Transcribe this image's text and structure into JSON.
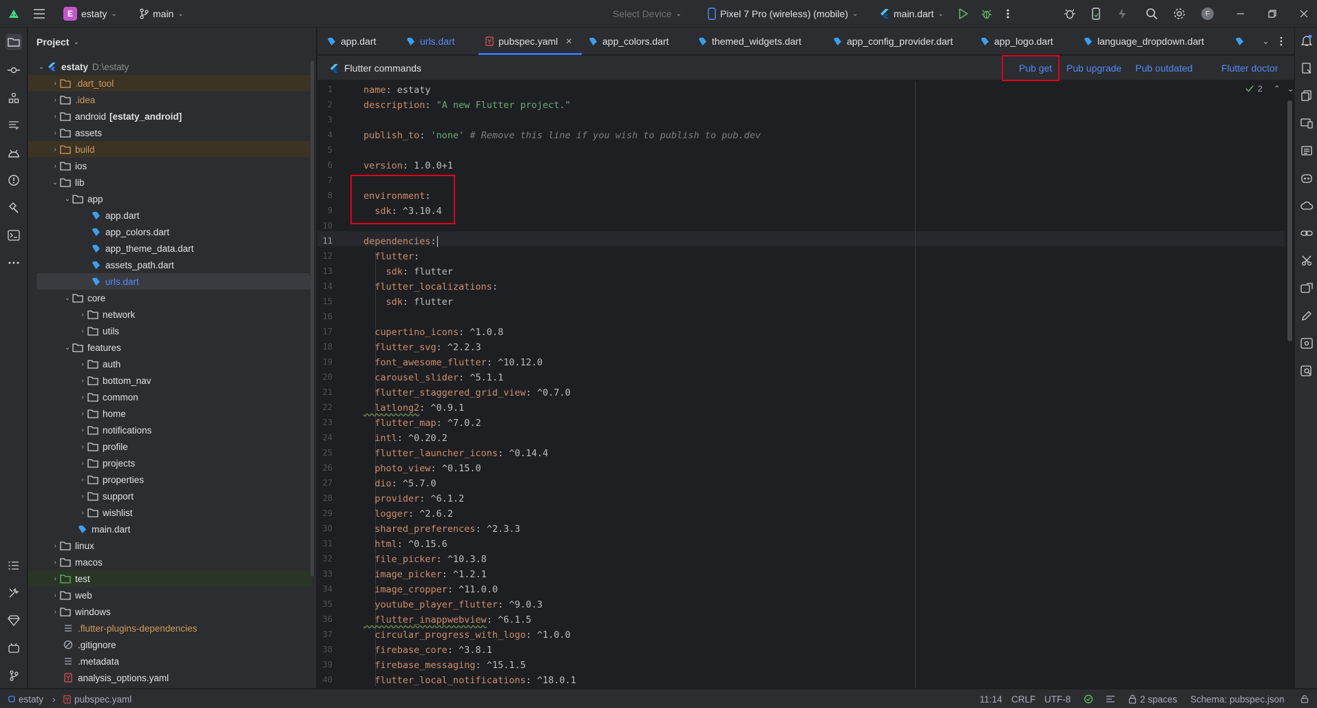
{
  "titlebar": {
    "project_badge": "E",
    "project_name": "estaty",
    "branch": "main",
    "select_device": "Select Device",
    "device": "Pixel 7 Pro (wireless) (mobile)",
    "run_config": "main.dart"
  },
  "project_panel": {
    "title": "Project",
    "root_name": "estaty",
    "root_path": "D:\\estaty",
    "items": [
      {
        "label": ".dart_tool",
        "suffix": ""
      },
      {
        "label": ".idea",
        "suffix": ""
      },
      {
        "label": "android",
        "suffix": "[estaty_android]"
      },
      {
        "label": "assets",
        "suffix": ""
      },
      {
        "label": "build",
        "suffix": ""
      },
      {
        "label": "ios",
        "suffix": ""
      },
      {
        "label": "lib",
        "suffix": ""
      },
      {
        "label": "app",
        "suffix": ""
      },
      {
        "label": "app.dart",
        "suffix": ""
      },
      {
        "label": "app_colors.dart",
        "suffix": ""
      },
      {
        "label": "app_theme_data.dart",
        "suffix": ""
      },
      {
        "label": "assets_path.dart",
        "suffix": ""
      },
      {
        "label": "urls.dart",
        "suffix": ""
      },
      {
        "label": "core",
        "suffix": ""
      },
      {
        "label": "network",
        "suffix": ""
      },
      {
        "label": "utils",
        "suffix": ""
      },
      {
        "label": "features",
        "suffix": ""
      },
      {
        "label": "auth",
        "suffix": ""
      },
      {
        "label": "bottom_nav",
        "suffix": ""
      },
      {
        "label": "common",
        "suffix": ""
      },
      {
        "label": "home",
        "suffix": ""
      },
      {
        "label": "notifications",
        "suffix": ""
      },
      {
        "label": "profile",
        "suffix": ""
      },
      {
        "label": "projects",
        "suffix": ""
      },
      {
        "label": "properties",
        "suffix": ""
      },
      {
        "label": "support",
        "suffix": ""
      },
      {
        "label": "wishlist",
        "suffix": ""
      },
      {
        "label": "main.dart",
        "suffix": ""
      },
      {
        "label": "linux",
        "suffix": ""
      },
      {
        "label": "macos",
        "suffix": ""
      },
      {
        "label": "test",
        "suffix": ""
      },
      {
        "label": "web",
        "suffix": ""
      },
      {
        "label": "windows",
        "suffix": ""
      },
      {
        "label": ".flutter-plugins-dependencies",
        "suffix": ""
      },
      {
        "label": ".gitignore",
        "suffix": ""
      },
      {
        "label": ".metadata",
        "suffix": ""
      },
      {
        "label": "analysis_options.yaml",
        "suffix": ""
      }
    ]
  },
  "tabs": [
    {
      "label": "app.dart"
    },
    {
      "label": "urls.dart"
    },
    {
      "label": "pubspec.yaml"
    },
    {
      "label": "app_colors.dart"
    },
    {
      "label": "themed_widgets.dart"
    },
    {
      "label": "app_config_provider.dart"
    },
    {
      "label": "app_logo.dart"
    },
    {
      "label": "language_dropdown.dart"
    }
  ],
  "flutter_commands": {
    "title": "Flutter commands",
    "pub_get": "Pub get",
    "pub_upgrade": "Pub upgrade",
    "pub_outdated": "Pub outdated",
    "flutter_doctor": "Flutter doctor"
  },
  "editor": {
    "inspection_count": "2",
    "line_numbers": [
      "1",
      "2",
      "3",
      "4",
      "5",
      "6",
      "7",
      "8",
      "9",
      "10",
      "11",
      "12",
      "13",
      "14",
      "15",
      "16",
      "17",
      "18",
      "19",
      "20",
      "21",
      "22",
      "23",
      "24",
      "25",
      "26",
      "27",
      "28",
      "29",
      "30",
      "31",
      "32",
      "33",
      "34",
      "35",
      "36",
      "37",
      "38",
      "39",
      "40"
    ],
    "lines": [
      [
        "name",
        ": estaty"
      ],
      [
        "description",
        ": ",
        "\"A new Flutter project.\""
      ],
      [
        ""
      ],
      [
        "publish_to",
        ": ",
        "'none'",
        " # Remove this line if you wish to publish to pub.dev"
      ],
      [
        ""
      ],
      [
        "version",
        ": 1.0.0+1"
      ],
      [
        ""
      ],
      [
        "environment",
        ":"
      ],
      [
        "  sdk",
        ": ^3.10.4"
      ],
      [
        ""
      ],
      [
        "dependencies",
        ":"
      ],
      [
        "  flutter",
        ":"
      ],
      [
        "    sdk",
        ": flutter"
      ],
      [
        "  flutter_localizations",
        ":"
      ],
      [
        "    sdk",
        ": flutter"
      ],
      [
        ""
      ],
      [
        "  cupertino_icons",
        ": ^1.0.8"
      ],
      [
        "  flutter_svg",
        ": ^2.2.3"
      ],
      [
        "  font_awesome_flutter",
        ": ^10.12.0"
      ],
      [
        "  carousel_slider",
        ": ^5.1.1"
      ],
      [
        "  flutter_staggered_grid_view",
        ": ^0.7.0"
      ],
      [
        "  latlong2",
        ": ^0.9.1"
      ],
      [
        "  flutter_map",
        ": ^7.0.2"
      ],
      [
        "  intl",
        ": ^0.20.2"
      ],
      [
        "  flutter_launcher_icons",
        ": ^0.14.4"
      ],
      [
        "  photo_view",
        ": ^0.15.0"
      ],
      [
        "  dio",
        ": ^5.7.0"
      ],
      [
        "  provider",
        ": ^6.1.2"
      ],
      [
        "  logger",
        ": ^2.6.2"
      ],
      [
        "  shared_preferences",
        ": ^2.3.3"
      ],
      [
        "  html",
        ": ^0.15.6"
      ],
      [
        "  file_picker",
        ": ^10.3.8"
      ],
      [
        "  image_picker",
        ": ^1.2.1"
      ],
      [
        "  image_cropper",
        ": ^11.0.0"
      ],
      [
        "  youtube_player_flutter",
        ": ^9.0.3"
      ],
      [
        "  flutter_inappwebview",
        ": ^6.1.5"
      ],
      [
        "  circular_progress_with_logo",
        ": ^1.0.0"
      ],
      [
        "  firebase_core",
        ": ^3.8.1"
      ],
      [
        "  firebase_messaging",
        ": ^15.1.5"
      ],
      [
        "  flutter_local_notifications",
        ": ^18.0.1"
      ]
    ]
  },
  "statusbar": {
    "project": "estaty",
    "file": "pubspec.yaml",
    "position": "11:14",
    "line_ending": "CRLF",
    "encoding": "UTF-8",
    "indent": "2 spaces",
    "schema": "Schema: pubspec.json"
  }
}
